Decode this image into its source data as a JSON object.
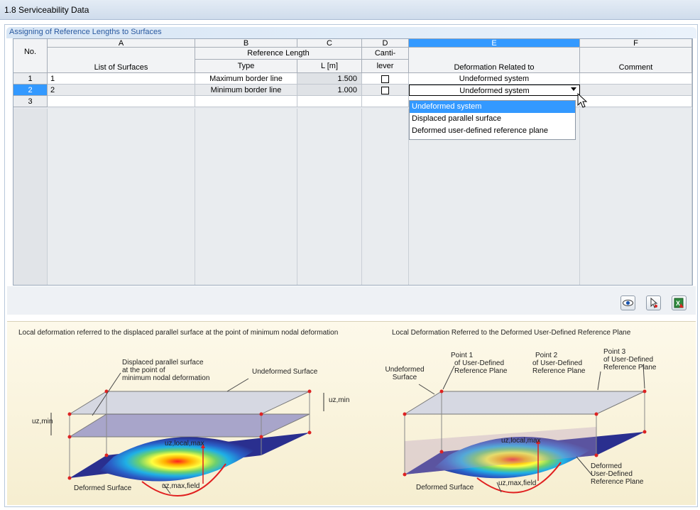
{
  "window": {
    "title": "1.8 Serviceability Data"
  },
  "section": {
    "title": "Assigning of Reference Lengths to Surfaces"
  },
  "table": {
    "col_letters": [
      "A",
      "B",
      "C",
      "D",
      "E",
      "F"
    ],
    "no_header": "No.",
    "group_reference_length": "Reference Length",
    "headers": {
      "list_of_surfaces": "List of Surfaces",
      "type": "Type",
      "length": "L [m]",
      "canti_top": "Canti-",
      "canti_bottom": "lever",
      "deformation": "Deformation Related to",
      "comment": "Comment"
    },
    "rows": [
      {
        "no": "1",
        "surfaces": "1",
        "type": "Maximum border line",
        "length": "1.500",
        "cantilever": false,
        "deformation": "Undeformed system",
        "comment": ""
      },
      {
        "no": "2",
        "surfaces": "2",
        "type": "Minimum border line",
        "length": "1.000",
        "cantilever": false,
        "deformation": "Undeformed system",
        "comment": ""
      },
      {
        "no": "3",
        "surfaces": "",
        "type": "",
        "length": "",
        "cantilever": null,
        "deformation": "",
        "comment": ""
      }
    ],
    "selected_row": 2,
    "selected_column": "E"
  },
  "dropdown": {
    "options": [
      "Undeformed system",
      "Displaced parallel surface",
      "Deformed user-defined reference plane"
    ],
    "highlighted_index": 0
  },
  "toolbar": {
    "buttons": [
      "eye-icon",
      "select-pointer-icon",
      "excel-export-icon"
    ]
  },
  "info": {
    "left_caption": "Local deformation referred to the displaced parallel surface at the point of minimum nodal deformation",
    "right_caption": "Local Deformation Referred to the Deformed User-Defined Reference Plane",
    "left_labels": {
      "displaced_line1": "Displaced parallel surface",
      "displaced_line2": "at the point of",
      "displaced_line3": "minimum nodal deformation",
      "undeformed": "Undeformed Surface",
      "uz_min": "uz,min",
      "uz_local_max": "uz,local,max",
      "uz_max_field": "uz,max,field",
      "deformed": "Deformed Surface"
    },
    "right_labels": {
      "undeformed_line1": "Undeformed",
      "undeformed_line2": "Surface",
      "point1_line1": "Point 1",
      "point1_line2": "of User-Defined",
      "point1_line3": "Reference Plane",
      "point2_line1": "Point 2",
      "point2_line2": "of User-Defined",
      "point2_line3": "Reference Plane",
      "point3_line1": "Point 3",
      "point3_line2": "of User-Defined",
      "point3_line3": "Reference Plane",
      "uz_local_max": "uz,local,max",
      "uz_max_field": "uz,max,field",
      "deformed": "Deformed Surface",
      "deformed_plane_line1": "Deformed",
      "deformed_plane_line2": "User-Defined",
      "deformed_plane_line3": "Reference Plane"
    }
  },
  "colors": {
    "accent": "#3399ff",
    "plane_edge": "#cc2222",
    "plate": "#2a2f8f"
  }
}
